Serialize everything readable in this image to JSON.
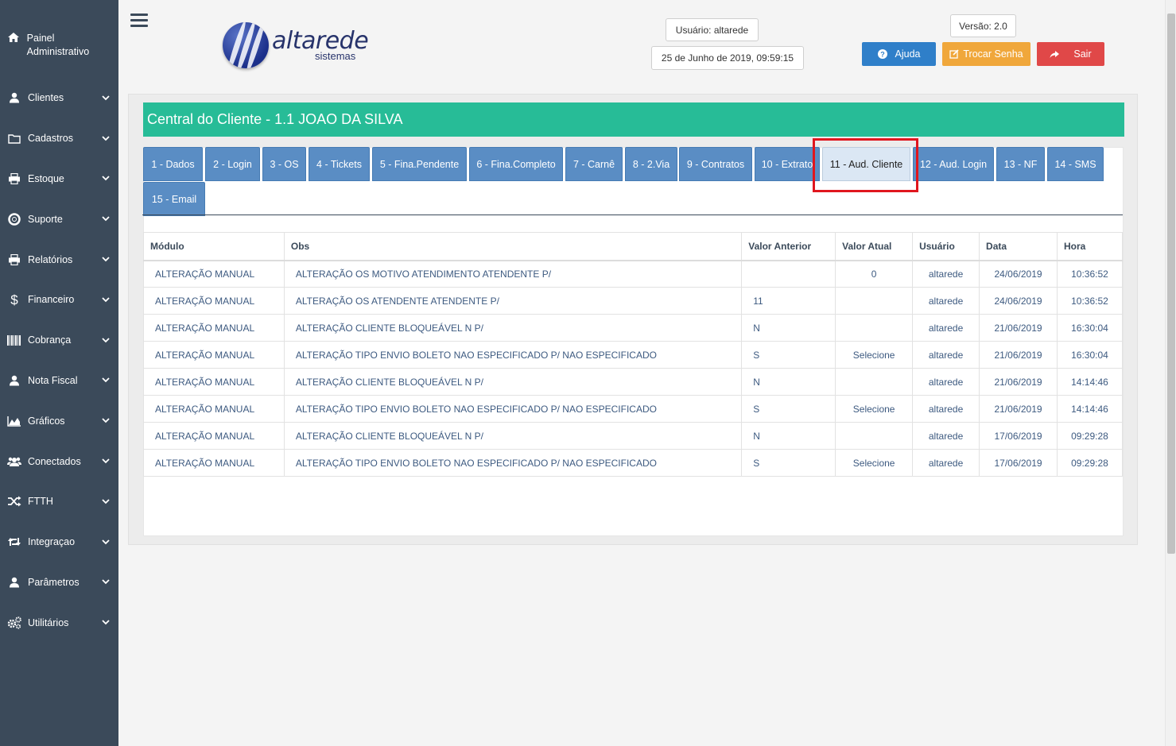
{
  "sidebar": {
    "home_label": "Painel Administrativo",
    "items": [
      {
        "label": "Clientes",
        "icon": "user-icon"
      },
      {
        "label": "Cadastros",
        "icon": "folder-icon"
      },
      {
        "label": "Estoque",
        "icon": "print-icon"
      },
      {
        "label": "Suporte",
        "icon": "lifebuoy-icon"
      },
      {
        "label": "Relatórios",
        "icon": "print-icon"
      },
      {
        "label": "Financeiro",
        "icon": "dollar-icon"
      },
      {
        "label": "Cobrança",
        "icon": "barcode-icon"
      },
      {
        "label": "Nota Fiscal",
        "icon": "user-icon"
      },
      {
        "label": "Gráficos",
        "icon": "chart-icon"
      },
      {
        "label": "Conectados",
        "icon": "users-icon"
      },
      {
        "label": "FTTH",
        "icon": "shuffle-icon"
      },
      {
        "label": "Integraçao",
        "icon": "retweet-icon"
      },
      {
        "label": "Parâmetros",
        "icon": "user-icon"
      },
      {
        "label": "Utilitários",
        "icon": "gears-icon"
      }
    ]
  },
  "header": {
    "logo_name": "altarede",
    "logo_sub": "sistemas",
    "user": "Usuário: altarede",
    "datetime": "25 de Junho de 2019, 09:59:15",
    "version": "Versão: 2.0",
    "help_label": "Ajuda",
    "change_pw_label": "Trocar Senha",
    "logout_label": "Sair",
    "colors": {
      "help": "#2f7fc9",
      "change_pw": "#f0a73b",
      "logout": "#e04848"
    }
  },
  "main": {
    "title": "Central do Cliente - 1.1 JOAO DA SILVA",
    "tabs": [
      "1 - Dados",
      "2 - Login",
      "3 - OS",
      "4 - Tickets",
      "5 - Fina.Pendente",
      "6 - Fina.Completo",
      "7 - Carnê",
      "8 - 2.Via",
      "9 - Contratos",
      "10 - Extrato",
      "11 - Aud. Cliente",
      "12 - Aud. Login",
      "13 - NF",
      "14 - SMS",
      "15 - Email"
    ],
    "active_tab": "11 - Aud. Cliente",
    "table": {
      "headers": [
        "Módulo",
        "Obs",
        "Valor Anterior",
        "Valor Atual",
        "Usuário",
        "Data",
        "Hora"
      ],
      "rows": [
        [
          "ALTERAÇÃO MANUAL",
          "ALTERAÇÃO OS MOTIVO ATENDIMENTO ATENDENTE P/",
          "",
          "0",
          "altarede",
          "24/06/2019",
          "10:36:52"
        ],
        [
          "ALTERAÇÃO MANUAL",
          "ALTERAÇÃO OS ATENDENTE ATENDENTE P/",
          "11",
          "",
          "altarede",
          "24/06/2019",
          "10:36:52"
        ],
        [
          "ALTERAÇÃO MANUAL",
          "ALTERAÇÃO CLIENTE BLOQUEÁVEL N P/",
          "N",
          "",
          "altarede",
          "21/06/2019",
          "16:30:04"
        ],
        [
          "ALTERAÇÃO MANUAL",
          "ALTERAÇÃO TIPO ENVIO BOLETO NAO ESPECIFICADO P/ NAO ESPECIFICADO",
          "S",
          "Selecione",
          "altarede",
          "21/06/2019",
          "16:30:04"
        ],
        [
          "ALTERAÇÃO MANUAL",
          "ALTERAÇÃO CLIENTE BLOQUEÁVEL N P/",
          "N",
          "",
          "altarede",
          "21/06/2019",
          "14:14:46"
        ],
        [
          "ALTERAÇÃO MANUAL",
          "ALTERAÇÃO TIPO ENVIO BOLETO NAO ESPECIFICADO P/ NAO ESPECIFICADO",
          "S",
          "Selecione",
          "altarede",
          "21/06/2019",
          "14:14:46"
        ],
        [
          "ALTERAÇÃO MANUAL",
          "ALTERAÇÃO CLIENTE BLOQUEÁVEL N P/",
          "N",
          "",
          "altarede",
          "17/06/2019",
          "09:29:28"
        ],
        [
          "ALTERAÇÃO MANUAL",
          "ALTERAÇÃO TIPO ENVIO BOLETO NAO ESPECIFICADO P/ NAO ESPECIFICADO",
          "S",
          "Selecione",
          "altarede",
          "17/06/2019",
          "09:29:28"
        ]
      ]
    }
  }
}
